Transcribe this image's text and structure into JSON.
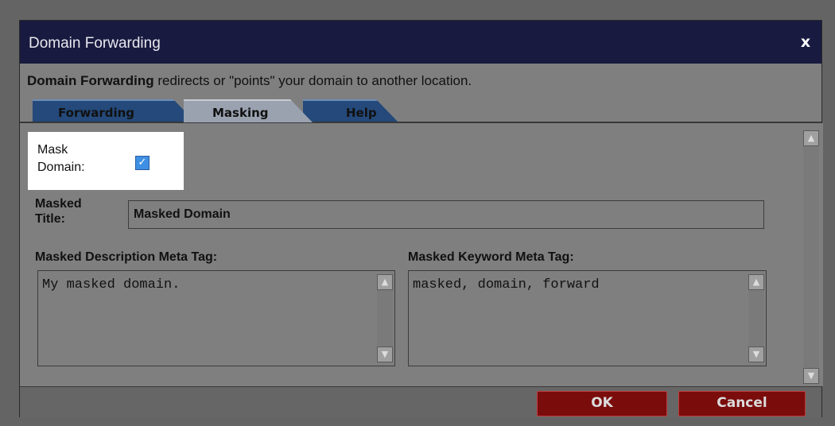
{
  "dialog": {
    "title": "Domain Forwarding",
    "close_label": "x",
    "description_bold": "Domain Forwarding",
    "description_rest": " redirects or \"points\" your domain to another location."
  },
  "tabs": [
    {
      "label": "Forwarding",
      "active": false
    },
    {
      "label": "Masking",
      "active": true
    },
    {
      "label": "Help",
      "active": false
    }
  ],
  "form": {
    "mask_domain_label_1": "Mask",
    "mask_domain_label_2": "Domain:",
    "mask_domain_checked": true,
    "masked_title_label_1": "Masked",
    "masked_title_label_2": "Title:",
    "masked_title_value": "Masked Domain",
    "description_label": "Masked Description Meta Tag:",
    "description_value": "My masked domain.",
    "keyword_label": "Masked Keyword Meta Tag:",
    "keyword_value": "masked, domain, forward"
  },
  "footer": {
    "ok_label": "OK",
    "cancel_label": "Cancel"
  },
  "icons": {
    "scroll_up": "chevron-up-icon",
    "scroll_down": "chevron-down-icon",
    "checkbox": "check-icon"
  },
  "colors": {
    "titlebar": "#191a40",
    "tab_active": "#9aa2b0",
    "tab_inactive": "#24497a",
    "button": "#7a0c0c",
    "checkbox": "#3f8fe4"
  }
}
